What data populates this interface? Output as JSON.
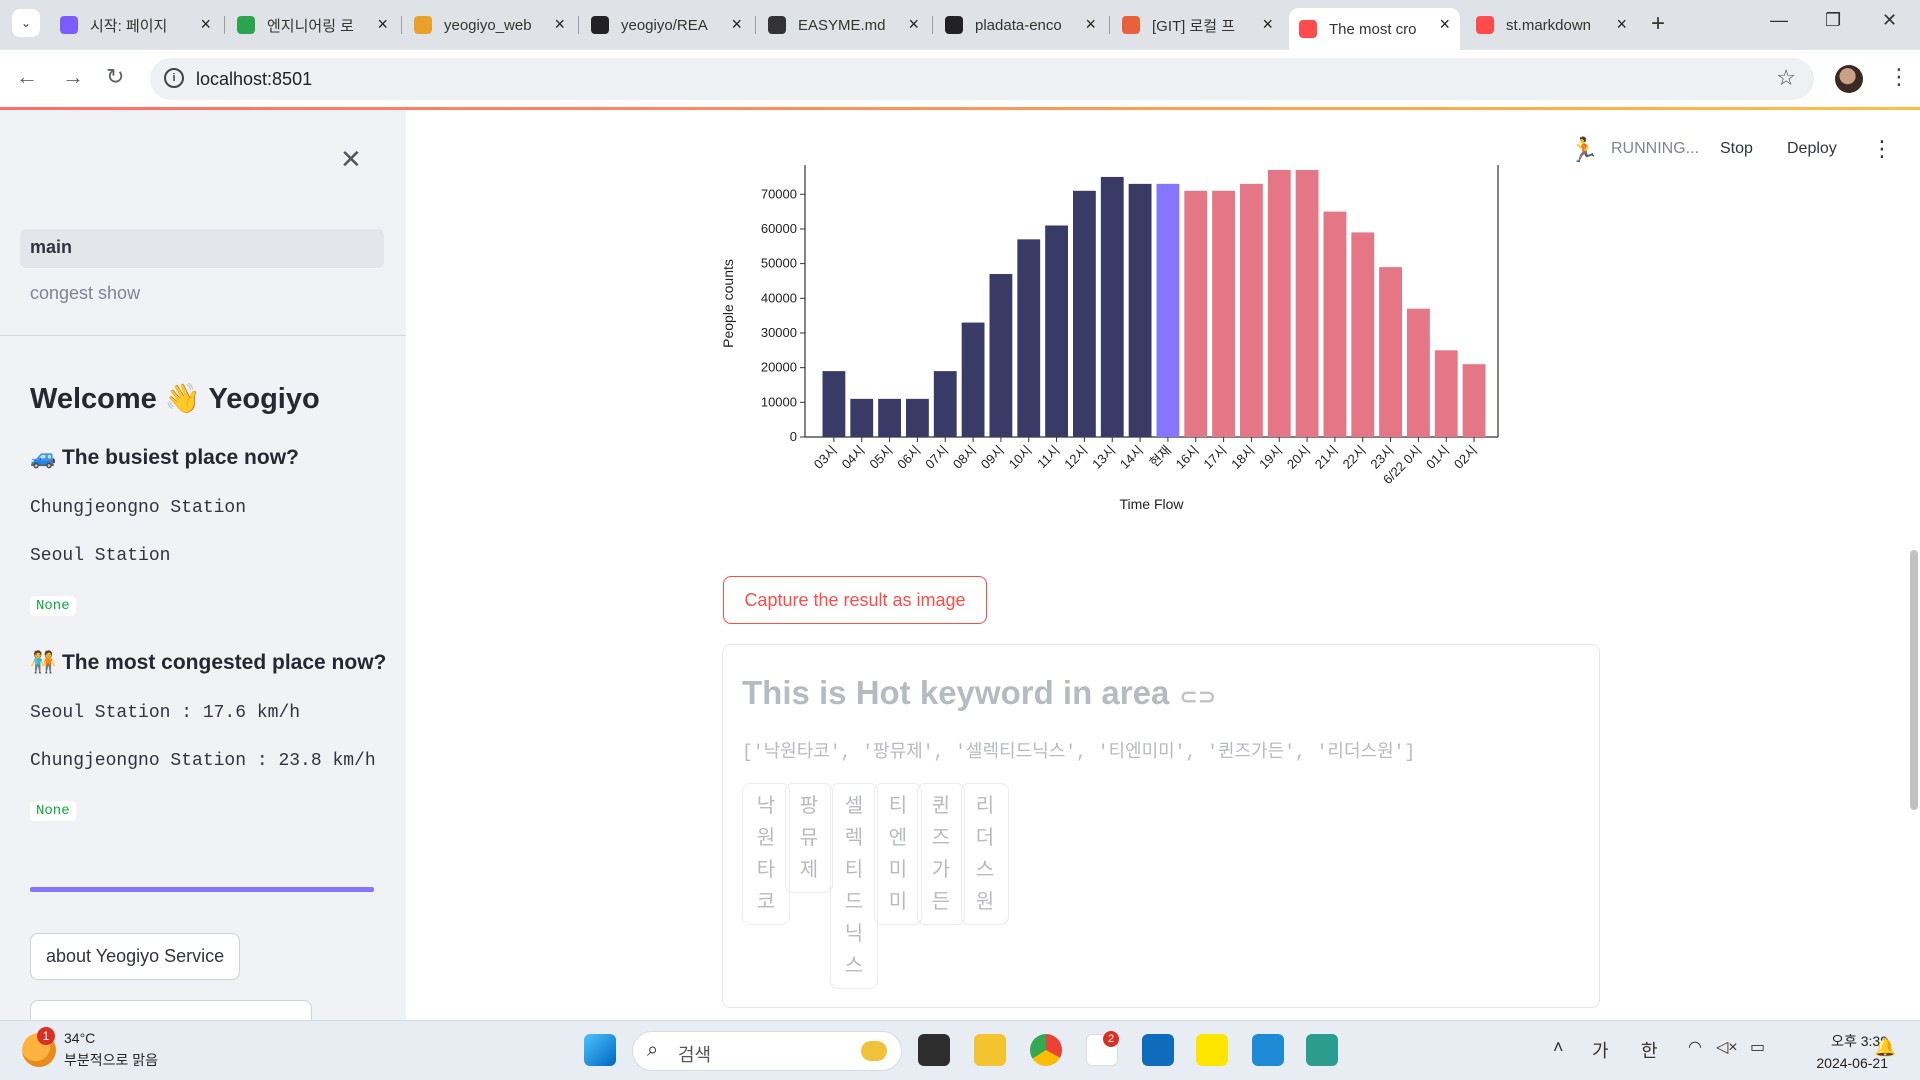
{
  "browser": {
    "tabs": [
      {
        "title": "시작: 페이지",
        "color": "#7b5cff"
      },
      {
        "title": "엔지니어링 로",
        "color": "#2aa44f"
      },
      {
        "title": "yeogiyo_web",
        "color": "#e8a22b"
      },
      {
        "title": "yeogiyo/REA",
        "color": "#222222"
      },
      {
        "title": "EASYME.md",
        "color": "#333333"
      },
      {
        "title": "pladata-enco",
        "color": "#222222"
      },
      {
        "title": "[GIT] 로컬 프",
        "color": "#e8603c"
      },
      {
        "title": "The most cro",
        "color": "#ff4b4b"
      },
      {
        "title": "st.markdown",
        "color": "#ff4b4b"
      }
    ],
    "url": "localhost:8501"
  },
  "sidebar": {
    "nav": [
      "main",
      "congest show"
    ],
    "welcome": "Welcome 👋 Yeogiyo",
    "busiest_heading": "🚙 The busiest place now?",
    "busiest_items": [
      "Chungjeongno Station",
      "Seoul Station"
    ],
    "none1": "None",
    "congested_heading": "🧑‍🤝‍🧑 The most congested place now?",
    "congested_items": [
      "Seoul Station : 17.6 km/h",
      "Chungjeongno Station : 23.8 km/h"
    ],
    "none2": "None",
    "about_button": "about Yeogiyo Service"
  },
  "header": {
    "status": "RUNNING...",
    "stop": "Stop",
    "deploy": "Deploy"
  },
  "chart_data": {
    "type": "bar",
    "categories": [
      "03시",
      "04시",
      "05시",
      "06시",
      "07시",
      "08시",
      "09시",
      "10시",
      "11시",
      "12시",
      "13시",
      "14시",
      "현재",
      "16시",
      "17시",
      "18시",
      "19시",
      "20시",
      "21시",
      "22시",
      "23시",
      "6/22 0시",
      "01시",
      "02시"
    ],
    "values": [
      19000,
      11000,
      11000,
      11000,
      19000,
      33000,
      47000,
      57000,
      61000,
      71000,
      75000,
      73000,
      73000,
      71000,
      71000,
      73000,
      77000,
      77000,
      65000,
      59000,
      49000,
      37000,
      25000,
      21000
    ],
    "colors": [
      "#3a3a66",
      "#3a3a66",
      "#3a3a66",
      "#3a3a66",
      "#3a3a66",
      "#3a3a66",
      "#3a3a66",
      "#3a3a66",
      "#3a3a66",
      "#3a3a66",
      "#3a3a66",
      "#3a3a66",
      "#8676ff",
      "#e57686",
      "#e57686",
      "#e57686",
      "#e57686",
      "#e57686",
      "#e57686",
      "#e57686",
      "#e57686",
      "#e57686",
      "#e57686",
      "#e57686"
    ],
    "yticks": [
      0,
      10000,
      20000,
      30000,
      40000,
      50000,
      60000,
      70000
    ],
    "ylim": [
      0,
      77000
    ],
    "xlabel": "Time Flow",
    "ylabel": "People counts"
  },
  "capture_button": "Capture the result as image",
  "keyword": {
    "title": "This is Hot keyword in area",
    "list_text": "['낙원타코', '팡뮤제', '셀렉티드닉스', '티엔미미', '퀸즈가든', '리더스원']",
    "words": [
      "낙원타코",
      "팡뮤제",
      "셀렉티드닉스",
      "티엔미미",
      "퀸즈가든",
      "리더스원"
    ]
  },
  "taskbar": {
    "weather_temp": "34°C",
    "weather_desc": "부분적으로 맑음",
    "weather_badge": "1",
    "search_placeholder": "검색",
    "ime1": "가",
    "ime2": "한",
    "time": "오후 3:39",
    "date": "2024-06-21",
    "slack_badge": "2"
  }
}
